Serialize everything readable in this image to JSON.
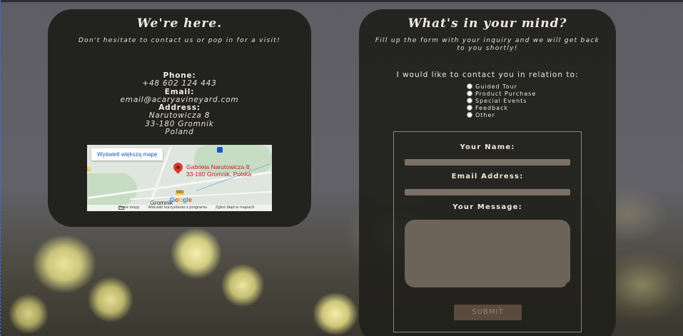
{
  "contact_card": {
    "title": "We're here.",
    "subtitle": "Don't hesitate to contact us or pop in for a visit!",
    "phone_label": "Phone:",
    "phone_value": "+48 602 124 443",
    "email_label": "Email:",
    "email_value": "email@acaryavineyard.com",
    "address_label": "Address:",
    "address_line1": "Narutowicza 8",
    "address_line2": "33-180 Gromnik",
    "address_line3": "Poland"
  },
  "map": {
    "enlarge_button": "Wyświetl większą mapę",
    "place_line1": "Gabriela Narutowicza 8,",
    "place_line2": "33-180 Gromnik, Polska",
    "town": "Gromnik",
    "road_number": "980",
    "left_badge": "0",
    "google": "Google",
    "footer_data": "Dane mapy",
    "footer_terms": "Warunki korzystania z programu",
    "footer_report": "Zgłoś błąd w mapach"
  },
  "form_card": {
    "title": "What's in your mind?",
    "subtitle": "Fill up the form with your inquiry and we will get back to you shortly!",
    "relation_question": "I would like to contact you in relation to:",
    "options": [
      "Guided Tour",
      "Product Purchase",
      "Special Events",
      "Feedback",
      "Other"
    ],
    "name_label": "Your Name:",
    "email_label": "Email Address:",
    "message_label": "Your Message:",
    "submit_label": "SUBMIT"
  },
  "colors": {
    "card_bg": "#20201c",
    "input_bg": "#7a7066",
    "submit_bg": "#5a4b3e"
  }
}
